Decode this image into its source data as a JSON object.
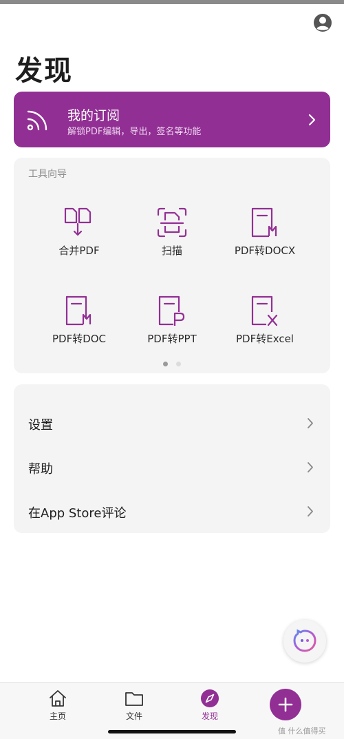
{
  "page": {
    "title": "发现"
  },
  "subscription": {
    "title": "我的订阅",
    "subtitle": "解锁PDF编辑，导出，签名等功能",
    "icon": "rss-icon"
  },
  "tools": {
    "section_label": "工具向导",
    "items": [
      {
        "label": "合并PDF",
        "icon": "merge-pdf-icon"
      },
      {
        "label": "扫描",
        "icon": "scan-icon"
      },
      {
        "label": "PDF转DOCX",
        "icon": "pdf-to-docx-icon"
      },
      {
        "label": "PDF转DOC",
        "icon": "pdf-to-doc-icon"
      },
      {
        "label": "PDF转PPT",
        "icon": "pdf-to-ppt-icon"
      },
      {
        "label": "PDF转Excel",
        "icon": "pdf-to-excel-icon"
      }
    ],
    "pager": {
      "pages": 2,
      "current": 1
    }
  },
  "menu": {
    "items": [
      {
        "label": "设置"
      },
      {
        "label": "帮助"
      },
      {
        "label": "在App Store评论"
      }
    ]
  },
  "tabbar": {
    "items": [
      {
        "label": "主页",
        "icon": "home-icon"
      },
      {
        "label": "文件",
        "icon": "folder-icon"
      },
      {
        "label": "发现",
        "icon": "compass-icon",
        "active": true
      }
    ],
    "add_icon": "plus-icon"
  },
  "watermark": "值 什么值得买",
  "colors": {
    "accent": "#922f94",
    "card_bg": "#f4f4f4",
    "muted": "#8f8f8f"
  }
}
